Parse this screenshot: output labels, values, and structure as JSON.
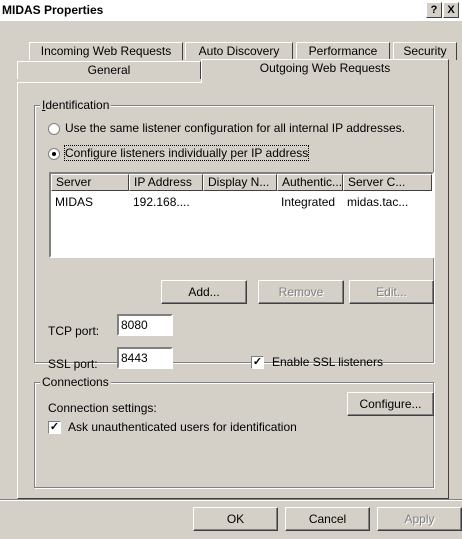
{
  "window": {
    "title": "MIDAS Properties",
    "help_btn": "?",
    "close_btn": "X"
  },
  "tabs_row1": [
    {
      "label": "Incoming Web Requests"
    },
    {
      "label": "Auto Discovery"
    },
    {
      "label": "Performance"
    },
    {
      "label": "Security"
    }
  ],
  "tabs_row2": [
    {
      "label": "General"
    },
    {
      "label": "Outgoing Web Requests"
    }
  ],
  "identification": {
    "group_label": "Identification",
    "radio_same": "Use the same listener configuration for all internal IP addresses.",
    "radio_individual": "Configure listeners individually per IP address",
    "selected": "individual"
  },
  "listeners_table": {
    "columns": [
      "Server",
      "IP Address",
      "Display N...",
      "Authentic...",
      "Server C..."
    ],
    "rows": [
      [
        "MIDAS",
        "192.168....",
        "",
        "Integrated",
        "midas.tac..."
      ]
    ]
  },
  "list_buttons": {
    "add": "Add...",
    "remove": "Remove",
    "edit": "Edit..."
  },
  "ports": {
    "tcp_label": "TCP port:",
    "tcp_value": "8080",
    "ssl_label": "SSL port:",
    "ssl_value": "8443",
    "enable_ssl_label": "Enable SSL listeners",
    "enable_ssl_checked": true
  },
  "connections": {
    "group_label": "Connections",
    "settings_label": "Connection settings:",
    "configure_btn": "Configure...",
    "ask_unauth_label": "Ask unauthenticated users for identification",
    "ask_unauth_checked": true
  },
  "dialog_buttons": {
    "ok": "OK",
    "cancel": "Cancel",
    "apply": "Apply"
  }
}
